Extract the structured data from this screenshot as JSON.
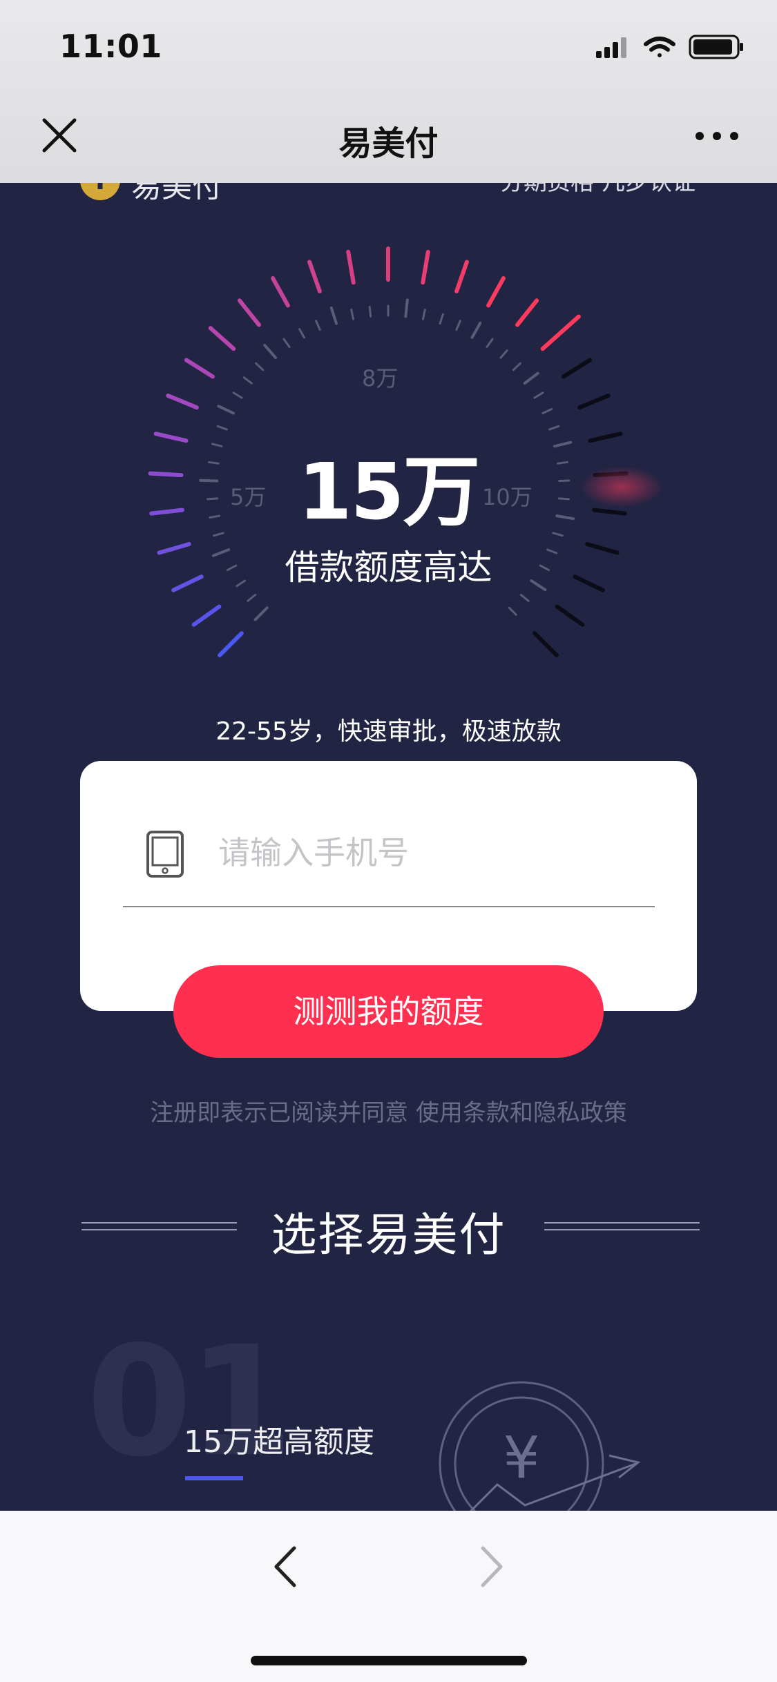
{
  "status_bar": {
    "time": "11:01"
  },
  "nav": {
    "title": "易美付"
  },
  "brand": {
    "logo_letter": "i",
    "name": "易美付",
    "tagline": "分期资格 几步认证"
  },
  "gauge": {
    "value_text": "15万",
    "label": "借款额度高达",
    "tick_labels": {
      "low": "5万",
      "mid": "8万",
      "high": "10万"
    }
  },
  "subtitle": "22-55岁，快速审批，极速放款",
  "form": {
    "phone_placeholder": "请输入手机号",
    "submit_label": "测测我的额度"
  },
  "terms": {
    "text": "注册即表示已阅读并同意 使用条款和隐私政策"
  },
  "section": {
    "heading": "选择易美付"
  },
  "feature": {
    "number": "01",
    "title": "15万超高额度",
    "illustration_symbol": "¥"
  },
  "colors": {
    "background": "#222443",
    "accent": "#ff2f50",
    "gauge_start": "#4a57f2",
    "gauge_end": "#ff3a5c",
    "inactive_tick": "#0b0c18"
  }
}
